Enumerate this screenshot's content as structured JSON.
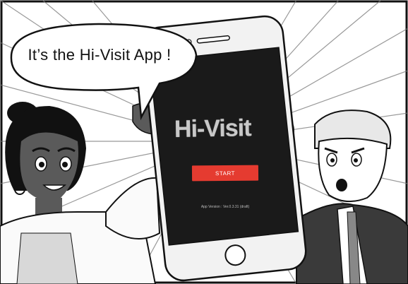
{
  "speech": {
    "text": "It’s the Hi-Visit App !"
  },
  "app": {
    "logo": "Hi-Visit",
    "start_label": "START",
    "version_text": "App Version : Ver.0.3.31 (draft)"
  },
  "colors": {
    "start_button": "#e53b30",
    "screen_bg": "#1a1a1a",
    "phone_body": "#f2f2f2"
  }
}
